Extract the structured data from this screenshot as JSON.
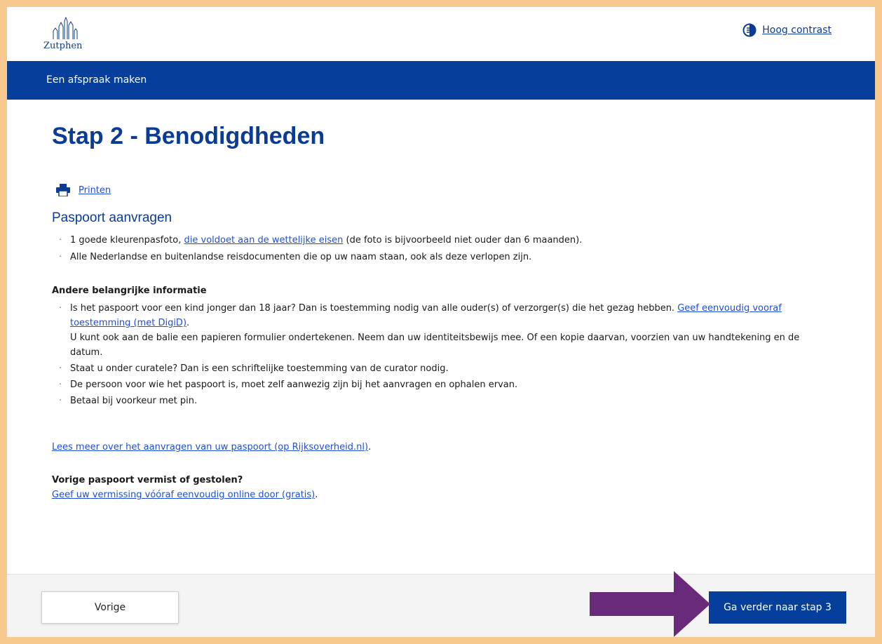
{
  "header": {
    "logo_text": "Zutphen",
    "contrast_label": "Hoog contrast"
  },
  "nav": {
    "title": "Een afspraak maken"
  },
  "page": {
    "title": "Stap 2 - Benodigdheden",
    "print_label": "Printen"
  },
  "passport": {
    "title": "Paspoort aanvragen",
    "items": [
      {
        "pre": "1 goede kleurenpasfoto, ",
        "link": "die voldoet aan de wettelijke eisen",
        "post": " (de foto is bijvoorbeeld niet ouder dan 6 maanden)."
      },
      {
        "text": "Alle Nederlandse en buitenlandse reisdocumenten die op uw naam staan, ook als deze verlopen zijn."
      }
    ]
  },
  "other": {
    "title": "Andere belangrijke informatie",
    "item1_text": "Is het paspoort voor een kind jonger dan 18 jaar? Dan is toestemming nodig van alle ouder(s) of verzorger(s) die het gezag hebben. ",
    "item1_link": "Geef eenvoudig vooraf toestemming (met DigiD)",
    "item1_link_post": ".",
    "item1_extra": "U kunt ook aan de balie een papieren formulier ondertekenen. Neem dan uw identiteitsbewijs mee. Of een kopie daarvan, voorzien van uw handtekening en de datum.",
    "item2": "Staat u onder curatele? Dan is een schriftelijke toestemming van de curator nodig.",
    "item3": "De persoon voor wie het paspoort is, moet zelf aanwezig zijn bij het aanvragen en ophalen ervan.",
    "item4": "Betaal bij voorkeur met pin."
  },
  "more": {
    "link": "Lees meer over het aanvragen van uw paspoort (op Rijksoverheid.nl)",
    "post": "."
  },
  "lost": {
    "title": "Vorige paspoort vermist of gestolen?",
    "link": "Geef uw vermissing vóóraf eenvoudig online door (gratis)",
    "post": "."
  },
  "footer": {
    "prev_label": "Vorige",
    "next_label": "Ga verder naar stap 3"
  },
  "colors": {
    "brand_blue": "#063f9b",
    "link_blue": "#1f4fd6",
    "frame_orange": "#f7c98e",
    "arrow_purple": "#6a2a7c"
  }
}
